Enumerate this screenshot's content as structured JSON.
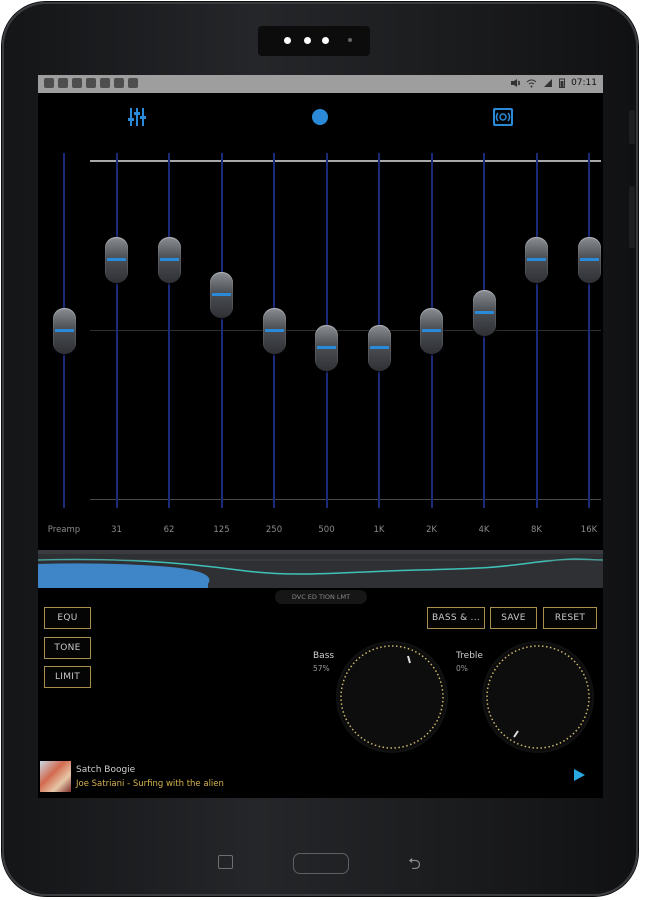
{
  "status_bar": {
    "time": "07:11"
  },
  "top_icons": [
    {
      "name": "equalizer-sliders-icon",
      "color": "#2a8ad8"
    },
    {
      "name": "dot-icon",
      "color": "#2a8ad8"
    },
    {
      "name": "surround-icon",
      "color": "#2a8ad8"
    }
  ],
  "equalizer": {
    "bands": [
      {
        "label": "Preamp",
        "level": 0.5
      },
      {
        "label": "31",
        "level": 0.7
      },
      {
        "label": "62",
        "level": 0.7
      },
      {
        "label": "125",
        "level": 0.6
      },
      {
        "label": "250",
        "level": 0.5
      },
      {
        "label": "500",
        "level": 0.45
      },
      {
        "label": "1K",
        "level": 0.45
      },
      {
        "label": "2K",
        "level": 0.5
      },
      {
        "label": "4K",
        "level": 0.55
      },
      {
        "label": "8K",
        "level": 0.7
      },
      {
        "label": "16K",
        "level": 0.7
      }
    ],
    "accent": "#2a8ad8"
  },
  "limit_tag": "DVC ED TION LMT",
  "mode_buttons": {
    "equ": "EQU",
    "tone": "TONE",
    "limit": "LIMIT"
  },
  "action_buttons": {
    "bass": "BASS & ...",
    "save": "SAVE",
    "reset": "RESET"
  },
  "dials": {
    "bass": {
      "label": "Bass",
      "value": "57%"
    },
    "treble": {
      "label": "Treble",
      "value": "0%"
    }
  },
  "now_playing": {
    "title": "Satch Boogie",
    "subtitle": "Joe Satriani - Surfing with the alien"
  },
  "bottom_nav": [
    {
      "name": "nav-grid-icon"
    },
    {
      "name": "nav-bars-icon"
    },
    {
      "name": "nav-search-icon"
    },
    {
      "name": "nav-menu-icon"
    }
  ]
}
